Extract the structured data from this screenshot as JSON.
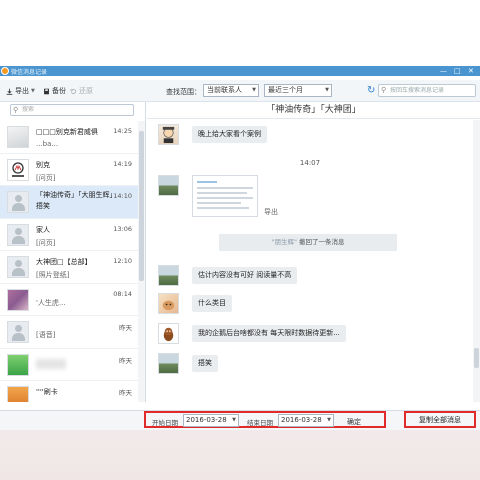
{
  "window": {
    "title": "微信消息记录",
    "controls": {
      "minimize": "—",
      "maximize": "□",
      "close": "✕"
    }
  },
  "toolbar": {
    "export_label": "导出",
    "backup_label": "备份",
    "restore_label": "还原",
    "scope_label": "查找范围：",
    "scope_value": "当前联系人",
    "range_value": "最近三个月",
    "search_placeholder": "按回车搜索消息记录"
  },
  "sidebar": {
    "search_placeholder": "搜索",
    "conversations": [
      {
        "name": "□□□别克新君威俱",
        "preview": "...ba...",
        "time": "14:25",
        "avatar": "photo-white"
      },
      {
        "name": "别克",
        "preview": "[问页]",
        "time": "14:19",
        "avatar": "buick-logo"
      },
      {
        "name": "「神油传奇」「大朋生辉」捂笑",
        "preview": "",
        "time": "14:10",
        "avatar": "default",
        "selected": true
      },
      {
        "name": "家人",
        "preview": "[问页]",
        "time": "13:06",
        "avatar": "default"
      },
      {
        "name": "大神团□【总部】",
        "preview": "[照片登纸]",
        "time": "12:10",
        "avatar": "default"
      },
      {
        "name": "",
        "preview": "'人生虎...",
        "time": "08:14",
        "avatar": "purple-photo"
      },
      {
        "name": "",
        "preview": "[语音]",
        "time": "昨天",
        "avatar": "default"
      },
      {
        "name": "",
        "preview": "",
        "time": "昨天",
        "avatar": "green-blur"
      },
      {
        "name": "   ''''刷卡",
        "preview": "",
        "time": "昨天",
        "avatar": "orange-blur"
      }
    ]
  },
  "chat": {
    "title": "「神油传奇」「大神团」",
    "messages": [
      {
        "kind": "text",
        "text": "晚上给大家看个案例",
        "avatar": "cartoon"
      },
      {
        "kind": "time",
        "text": "14:07"
      },
      {
        "kind": "image",
        "avatar": "landscape",
        "export_label": "导出"
      },
      {
        "kind": "system",
        "actor": "\"朋生辉\"",
        "text": " 撤回了一条消息"
      },
      {
        "kind": "text",
        "text": "估计内容没有可好 阅读量不高",
        "avatar": "landscape"
      },
      {
        "kind": "text",
        "text": "什么类目",
        "avatar": "puppy"
      },
      {
        "kind": "text",
        "text": "我的企鹅后台啥都没有 每天限时数据待更新...",
        "avatar": "squirrel"
      },
      {
        "kind": "text",
        "text": "捂笑",
        "avatar": "landscape"
      }
    ]
  },
  "filter": {
    "start_label": "开始日期",
    "start_value": "2016-03-28",
    "end_label": "结束日期",
    "end_value": "2016-03-28",
    "confirm_label": "确定",
    "copy_all_label": "复制全部消息"
  },
  "colors": {
    "titlebar": "#4a95cf",
    "selected": "#dbe9f8",
    "highlight_border": "#e12a2a",
    "accent": "#2d7fd2"
  }
}
